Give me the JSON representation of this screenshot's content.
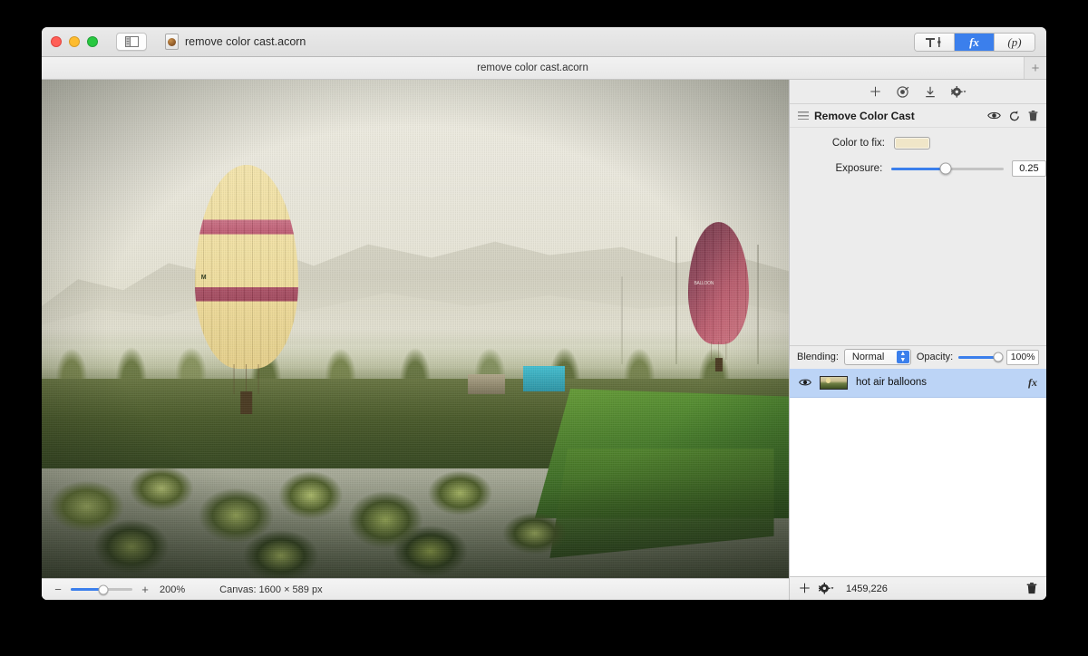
{
  "window": {
    "traffic_lights": [
      "close",
      "minimize",
      "zoom"
    ],
    "sidebar_toggle_icon": "sidebar-toggle-icon",
    "document_title": "remove color cast.acorn",
    "document_icon": "acorn-document-icon"
  },
  "toolbar": {
    "segments": [
      {
        "label": "",
        "icon": "tools-icon",
        "active": false,
        "name": "tools"
      },
      {
        "label": "fx",
        "icon": "fx-icon",
        "active": true,
        "name": "filters"
      },
      {
        "label": "(p)",
        "icon": "presets-icon",
        "active": false,
        "name": "presets"
      }
    ],
    "active_accent": "#3b7fec"
  },
  "tabbar": {
    "tab_title": "remove color cast.acorn",
    "new_tab_label": "+"
  },
  "canvas": {
    "photo_alt": "hot air balloons over palm groves",
    "balloons": [
      {
        "name": "yellow-striped-balloon",
        "mark": "M"
      },
      {
        "name": "red-balloon",
        "mark": "BALLOON"
      }
    ]
  },
  "statusbar": {
    "zoom_out_label": "−",
    "zoom_in_label": "+",
    "zoom_value": "200%",
    "zoom_percent": 53,
    "canvas_size": "Canvas: 1600 × 589 px"
  },
  "panel": {
    "tools": [
      {
        "name": "add-filter-icon",
        "glyph": "+"
      },
      {
        "name": "filter-target-icon",
        "glyph": "◎"
      },
      {
        "name": "download-icon",
        "glyph": "↓"
      },
      {
        "name": "gear-menu-icon",
        "glyph": "⚙"
      }
    ],
    "filter": {
      "title": "Remove Color Cast",
      "grip_icon": "drag-grip-icon",
      "actions": [
        {
          "name": "visibility-eye-icon",
          "glyph": "👁"
        },
        {
          "name": "reset-icon",
          "glyph": "↺"
        },
        {
          "name": "delete-icon",
          "glyph": "🗑"
        }
      ],
      "params": [
        {
          "label": "Color to fix:",
          "type": "color",
          "value": "#f0e6c8",
          "name": "color-to-fix-swatch"
        },
        {
          "label": "Exposure:",
          "type": "slider",
          "value": "0.25",
          "slider_percent": 48,
          "name": "exposure-slider"
        }
      ]
    },
    "blending": {
      "label": "Blending:",
      "mode": "Normal",
      "modes": [
        "Normal"
      ],
      "opacity_label": "Opacity:",
      "opacity_value": "100%",
      "opacity_percent": 92
    },
    "layers": [
      {
        "name": "hot air balloons",
        "visible": true,
        "has_fx": true,
        "fx_label": "fx",
        "selected": true
      }
    ],
    "footer": {
      "add_layer_label": "+",
      "gear_label": "⚙",
      "coordinates": "1459,226",
      "delete_icon": "trash-icon"
    }
  }
}
